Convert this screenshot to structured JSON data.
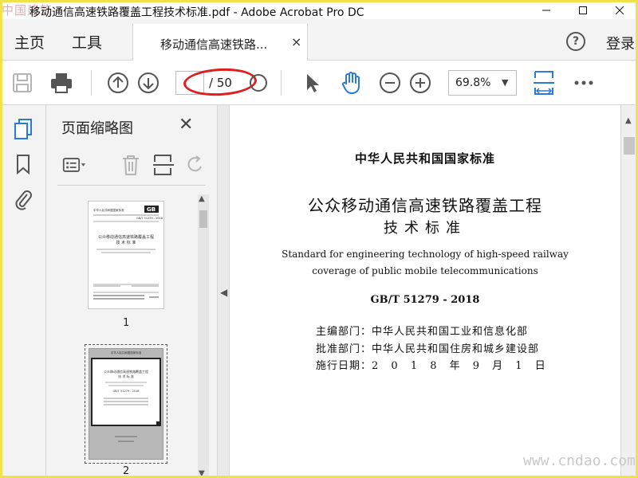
{
  "window": {
    "title_watermark": "中国建筑",
    "title": "移动通信高速铁路覆盖工程技术标准.pdf - Adobe Acrobat Pro DC"
  },
  "nav": {
    "home": "主页",
    "tools": "工具",
    "doc_tab": "移动通信高速铁路...",
    "doc_tab_close": "×",
    "help": "?",
    "sign_in": "登录"
  },
  "toolbar": {
    "page_current": "",
    "page_total": "/ 50",
    "zoom": "69.8%",
    "zoom_caret": "▼"
  },
  "panel": {
    "title": "页面缩略图",
    "close": "✕",
    "thumbnails": [
      {
        "label": "1",
        "header": "中华人民共和国国家标准",
        "badge": "GB",
        "code": "GB/T 51279 - 2018",
        "title": "公众移动通信高速铁路覆盖工程",
        "subtitle": "技 术 标 准",
        "en": "Standard for engineering technology of high-speed railway coverage of public mobile telecommunications",
        "dates": "2018-01-16 发布      2018-09-01 实施",
        "issuer": "中华人民共和国住房和城乡建设部  中华人民共和国国家质量监督检验检疫总局  联合发布"
      },
      {
        "label": "2",
        "header": "中华人民共和国国家标准",
        "title": "公众移动通信高速铁路覆盖工程",
        "subtitle": "技 术 标 准",
        "code": "GB/T 51279 - 2018"
      }
    ]
  },
  "document": {
    "standard_header": "中华人民共和国国家标准",
    "title_line1": "公众移动通信高速铁路覆盖工程",
    "title_line2": "技术标准",
    "english_line1": "Standard for engineering technology of high-speed railway",
    "english_line2": "coverage of public mobile telecommunications",
    "code": "GB/T 51279 - 2018",
    "editor_label": "主编部门：",
    "editor_value": "中华人民共和国工业和信息化部",
    "approver_label": "批准部门：",
    "approver_value": "中华人民共和国住房和城乡建设部",
    "effective_label": "施行日期：",
    "effective_value": "2 0 1 8 年 9 月 1 日"
  },
  "watermark": "www.cndao.com",
  "colors": {
    "accent_blue": "#2b7bd6",
    "annotation_red": "#e02020",
    "frame_yellow": "#f2e24a"
  }
}
